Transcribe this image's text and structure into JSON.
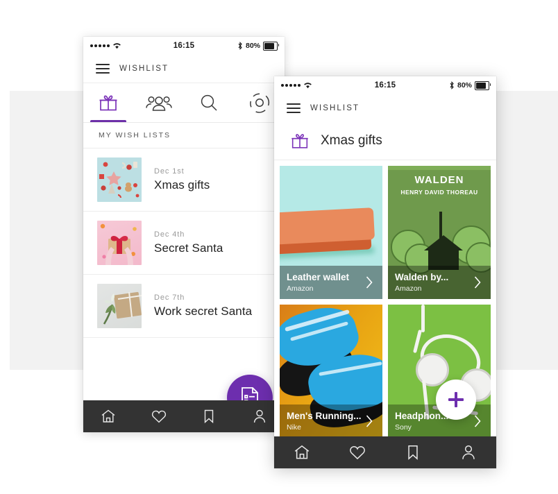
{
  "colors": {
    "accent": "#6d2eae",
    "nav_bar": "#333333",
    "bg_panel": "#f2f2f2",
    "caption_overlay": "rgba(0,0,0,0.38)"
  },
  "status_bar": {
    "signal_dots": 5,
    "wifi_icon": "wifi-icon",
    "time": "16:15",
    "bluetooth_icon": "bluetooth-icon",
    "battery_percent": "80%",
    "battery_icon": "battery-icon"
  },
  "back_phone": {
    "app_bar": {
      "menu_icon": "hamburger-menu-icon",
      "brand": "WISHLIST"
    },
    "tabs": [
      {
        "name": "tab-gifts",
        "icon": "gift-icon",
        "active": true
      },
      {
        "name": "tab-friends",
        "icon": "people-icon",
        "active": false
      },
      {
        "name": "tab-search",
        "icon": "search-icon",
        "active": false
      },
      {
        "name": "tab-settings",
        "icon": "gear-icon",
        "active": false
      }
    ],
    "section_header": "MY WISH LISTS",
    "lists": [
      {
        "date": "Dec 1st",
        "title": "Xmas gifts",
        "thumb": "xmas-flatlay-thumbnail"
      },
      {
        "date": "Dec 4th",
        "title": "Secret Santa",
        "thumb": "gift-hands-thumbnail"
      },
      {
        "date": "Dec 7th",
        "title": "Work secret Santa",
        "thumb": "kraft-gift-thumbnail"
      }
    ],
    "fab": {
      "icon": "new-list-icon",
      "name": "create-list-fab"
    },
    "bottom_nav": [
      {
        "name": "nav-home",
        "icon": "home-icon"
      },
      {
        "name": "nav-likes",
        "icon": "heart-icon"
      },
      {
        "name": "nav-saved",
        "icon": "bookmark-icon"
      },
      {
        "name": "nav-profile",
        "icon": "person-icon"
      }
    ]
  },
  "front_phone": {
    "app_bar": {
      "menu_icon": "hamburger-menu-icon",
      "brand": "WISHLIST"
    },
    "list_title": {
      "icon": "gift-icon",
      "text": "Xmas gifts"
    },
    "products": [
      {
        "name": "Leather wallet",
        "brand": "Amazon",
        "art": "orange-leather-wallet-on-mint",
        "chevron": "chevron-right-icon"
      },
      {
        "name": "Walden by...",
        "brand": "Amazon",
        "art": "walden-book-cover",
        "cover_title": "WALDEN",
        "cover_author": "HENRY DAVID THOREAU",
        "chevron": "chevron-right-icon"
      },
      {
        "name": "Men's Running...",
        "brand": "Nike",
        "art": "blue-running-shoes-on-orange",
        "chevron": "chevron-right-icon"
      },
      {
        "name": "Headphon...",
        "brand": "Sony",
        "art": "white-headphones-on-green",
        "chevron": "chevron-right-icon"
      }
    ],
    "fab": {
      "icon": "plus-icon",
      "name": "add-item-fab"
    },
    "bottom_nav": [
      {
        "name": "nav-home",
        "icon": "home-icon"
      },
      {
        "name": "nav-likes",
        "icon": "heart-icon"
      },
      {
        "name": "nav-saved",
        "icon": "bookmark-icon"
      },
      {
        "name": "nav-profile",
        "icon": "person-icon"
      }
    ]
  }
}
